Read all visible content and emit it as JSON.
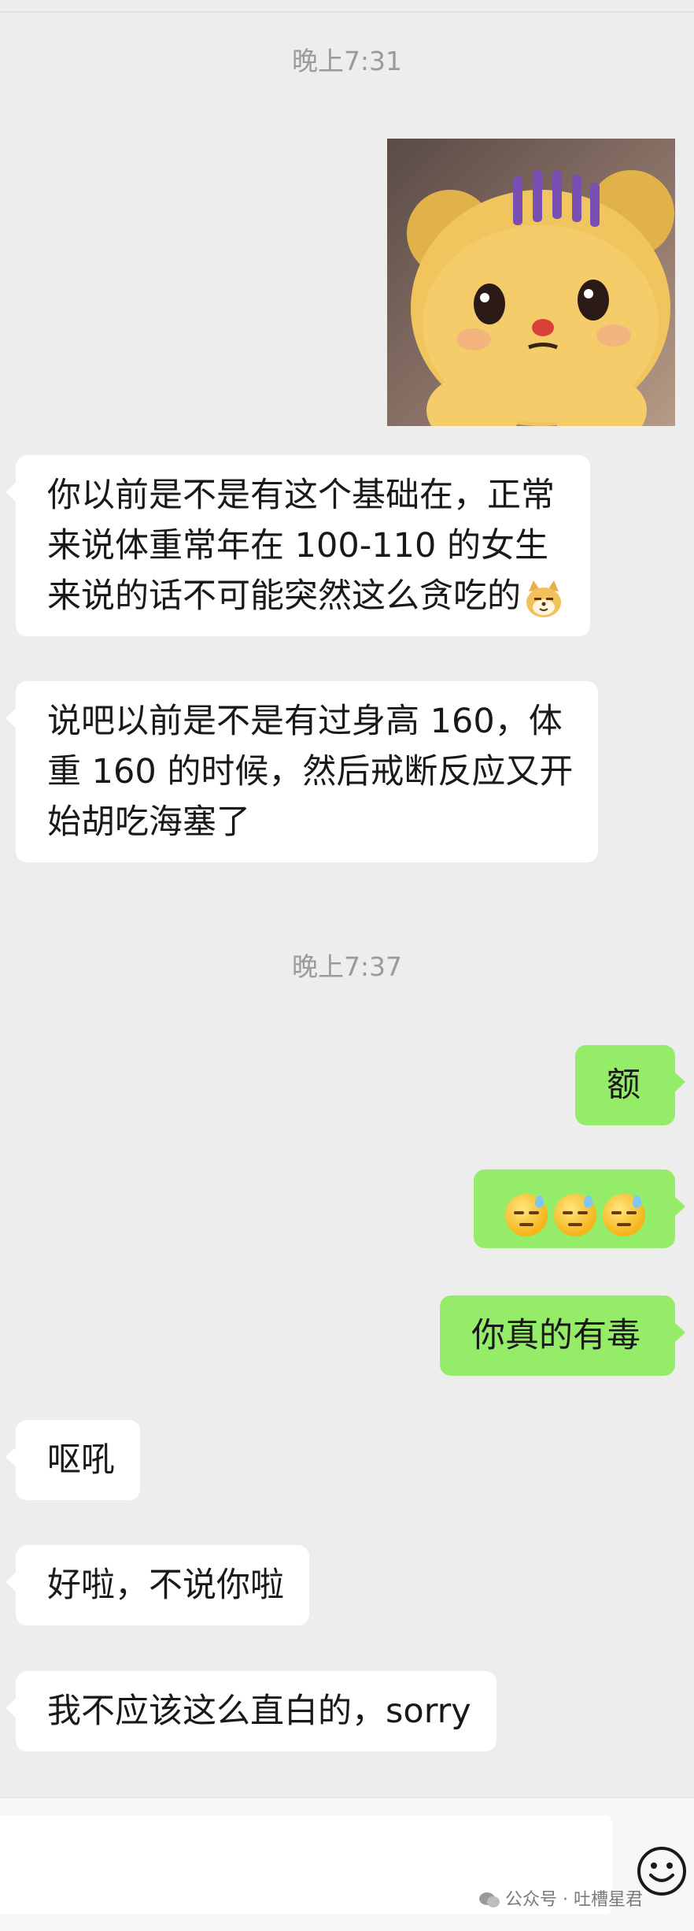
{
  "chat": {
    "timestamp_1": "晚上7:31",
    "msg_1": {
      "line_1": "你以前是不是有这个基础在，正常",
      "line_2": "来说体重常年在 100-110 的女生",
      "line_3": "来说的话不可能突然这么贪吃的"
    },
    "msg_2": {
      "line_1": "说吧以前是不是有过身高 160，体",
      "line_2": "重 160 的时候，然后戒断反应又开",
      "line_3": "始胡吃海塞了"
    },
    "timestamp_2": "晚上7:37",
    "msg_3": "额",
    "msg_5": "你真的有毒",
    "msg_6": "呕吼",
    "msg_7": "好啦，不说你啦",
    "msg_8": "我不应该这么直白的，sorry"
  },
  "icons": {
    "sticker": "teddy-bear-sticker",
    "emoji_1": "downcast-face-with-sweat-emoji",
    "emoji_cat": "doge-cat-emoji",
    "emoji_button": "smiley-face-icon"
  },
  "watermark": {
    "text": "公众号 · 吐槽星君"
  },
  "colors": {
    "background": "#ededed",
    "incoming_bubble": "#ffffff",
    "outgoing_bubble": "#95ec69",
    "timestamp": "#9a9a9a"
  }
}
